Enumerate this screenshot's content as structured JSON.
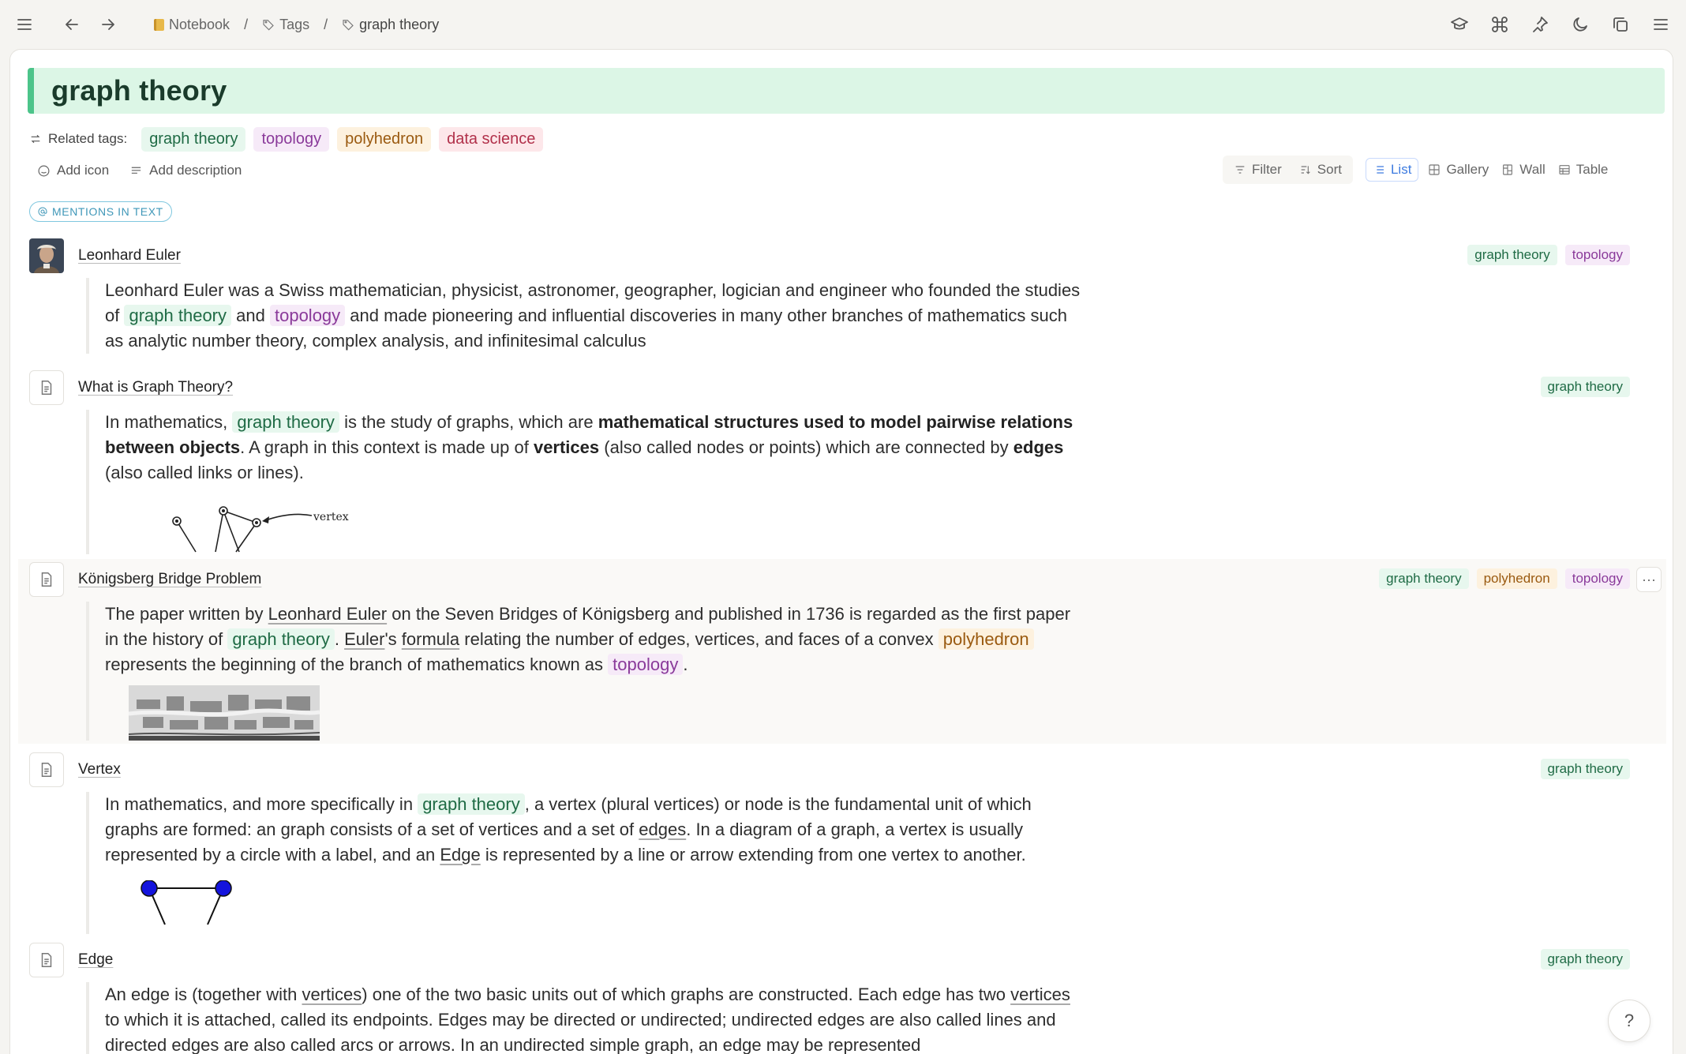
{
  "breadcrumbs": {
    "notebook": "Notebook",
    "tags": "Tags",
    "current": "graph theory",
    "separator": "/"
  },
  "page": {
    "title": "graph theory",
    "related_label": "Related tags:",
    "related_tags": [
      "graph theory",
      "topology",
      "polyhedron",
      "data science"
    ],
    "add_icon": "Add icon",
    "add_description": "Add description",
    "mentions_label": "MENTIONS IN TEXT"
  },
  "toolbar": {
    "filter": "Filter",
    "sort": "Sort",
    "views": [
      "List",
      "Gallery",
      "Wall",
      "Table"
    ],
    "active_view": "List"
  },
  "entries": [
    {
      "title": "Leonhard Euler",
      "tags": [
        "graph theory",
        "topology"
      ],
      "body": {
        "t1": "Leonhard Euler was a Swiss mathematician, physicist, astronomer, geographer, logician and engineer who founded the studies of",
        "m1": "graph theory",
        "t2": "and",
        "m2": "topology",
        "t3": "and made pioneering and influential discoveries in many other branches of mathematics such as analytic number theory, complex analysis, and infinitesimal calculus"
      }
    },
    {
      "title": "What is Graph Theory?",
      "tags": [
        "graph theory"
      ],
      "body": {
        "t1": "In mathematics,",
        "m1": "graph theory",
        "t2": "is the study of graphs, which are",
        "b1": "mathematical structures used to model pairwise relations between objects",
        "t3": ". A graph in this context is made up of",
        "b2": "vertices",
        "t4": "(also called nodes or points) which are connected by",
        "b3": "edges",
        "t5": "(also called links or lines).",
        "figure_label": "vertex"
      }
    },
    {
      "title": "Königsberg Bridge Problem",
      "tags": [
        "graph theory",
        "polyhedron",
        "topology"
      ],
      "more": "···",
      "body": {
        "t1": "The paper written by",
        "l1": "Leonhard Euler",
        "t2": "on the Seven Bridges of Königsberg and published in 1736 is regarded as the first paper in the history of",
        "m1": "graph theory",
        "t3": ".",
        "l2": "Euler",
        "t4": "'s",
        "l3": "formula",
        "t5": "relating the number of edges, vertices, and faces of a convex",
        "m2": "polyhedron",
        "t6": "represents the beginning of the branch of mathematics known as",
        "m3": "topology",
        "t7": "."
      }
    },
    {
      "title": "Vertex",
      "tags": [
        "graph theory"
      ],
      "body": {
        "t1": "In mathematics, and more specifically in",
        "m1": "graph theory",
        "t2": ", a vertex (plural vertices) or node is the fundamental unit of which graphs are formed: an graph consists of a set of vertices and a set of",
        "l1": "edges",
        "t3": ". In a diagram of a graph, a vertex is usually represented by a circle with a label, and an",
        "l2": "Edge",
        "t4": "is represented by a line or arrow extending from one vertex to another."
      }
    },
    {
      "title": "Edge",
      "tags": [
        "graph theory"
      ],
      "body": {
        "t1": "An edge is (together with",
        "l1": "vertices",
        "t2": ") one of the two basic units out of which graphs are constructed. Each edge has two",
        "l2": "vertices",
        "t3": "to which it is attached, called its endpoints. Edges may be directed or undirected; undirected edges are also called lines and directed edges are also called arcs or arrows. In an undirected simple graph, an edge may be represented"
      }
    }
  ],
  "help_label": "?",
  "colors": {
    "tag_green": "#e7f7ee",
    "tag_purple": "#f6eaf8",
    "tag_yellow": "#fdf1de",
    "tag_red": "#fde7ea",
    "accent_blue": "#3d7be0",
    "title_bg": "#dcf6e6"
  },
  "icons": [
    "menu-icon",
    "back-arrow-icon",
    "forward-arrow-icon",
    "notebook-icon",
    "tag-icon",
    "graduation-cap-icon",
    "command-icon",
    "pin-icon",
    "moon-icon",
    "copy-icon",
    "hamburger-icon",
    "document-icon",
    "filter-icon",
    "sort-icon",
    "list-icon",
    "gallery-icon",
    "wall-icon",
    "table-icon",
    "smiley-icon",
    "text-lines-icon",
    "at-sign-icon",
    "related-icon"
  ]
}
